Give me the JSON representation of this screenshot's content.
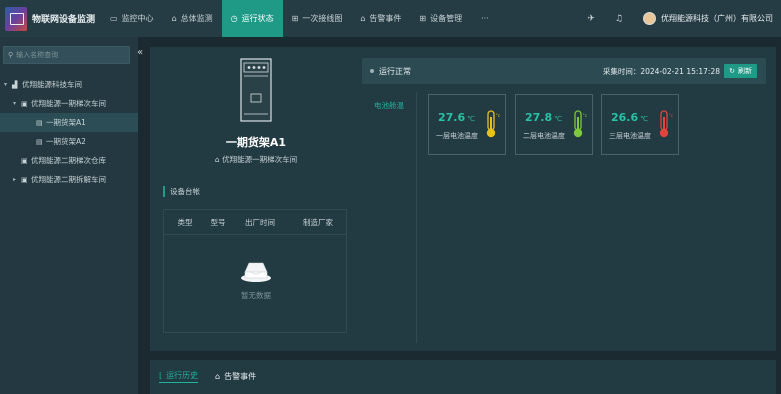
{
  "app": {
    "title": "物联网设备监测"
  },
  "nav": {
    "items": [
      {
        "label": "监控中心",
        "icon": "monitor-icon"
      },
      {
        "label": "总体监测",
        "icon": "home-icon"
      },
      {
        "label": "运行状态",
        "icon": "clock-icon",
        "active": true
      },
      {
        "label": "一次接线图",
        "icon": "bank-icon"
      },
      {
        "label": "告警事件",
        "icon": "alarm-icon"
      },
      {
        "label": "设备管理",
        "icon": "bank-icon"
      }
    ],
    "more": "···"
  },
  "user": {
    "company": "优翔能源科技（广州）有限公司"
  },
  "sidebar": {
    "search_placeholder": "输入名称查询",
    "tree": [
      {
        "label": "优翔能源科技车间",
        "level": 0,
        "expanded": true
      },
      {
        "label": "优翔能源一期梯次车间",
        "level": 1,
        "expanded": true
      },
      {
        "label": "一期货架A1",
        "level": 2,
        "selected": true
      },
      {
        "label": "一期货架A2",
        "level": 2
      },
      {
        "label": "优翔能源二期梯次仓库",
        "level": 1
      },
      {
        "label": "优翔能源二期拆解车间",
        "level": 1,
        "collapsed": true
      }
    ]
  },
  "device": {
    "name": "一期货架A1",
    "location": "优翔能源一期梯次车间"
  },
  "ledger": {
    "title": "设备台帐",
    "columns": [
      "类型",
      "型号",
      "出厂时间",
      "制造厂家"
    ],
    "empty_text": "暂无数据"
  },
  "status": {
    "text": "运行正常",
    "collect_label": "采集时间：2024-02-21 15:17:28",
    "refresh_label": "刷新"
  },
  "side_tab": {
    "label": "电池舱温"
  },
  "sensors": [
    {
      "value": "27.6",
      "unit": "℃",
      "label": "一层电池温度",
      "color": "#e8c21a"
    },
    {
      "value": "27.8",
      "unit": "℃",
      "label": "二层电池温度",
      "color": "#7ec93a"
    },
    {
      "value": "26.6",
      "unit": "℃",
      "label": "三层电池温度",
      "color": "#e0443a"
    }
  ],
  "bottom_tabs": [
    {
      "label": "运行历史",
      "active": true
    },
    {
      "label": "告警事件",
      "active": false
    }
  ],
  "colors": {
    "accent": "#1f9a87",
    "bg": "#1b2a30",
    "topbar": "#263c44"
  }
}
